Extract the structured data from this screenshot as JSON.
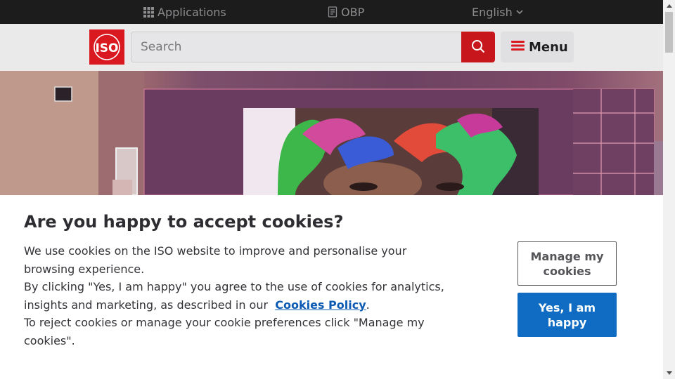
{
  "topbar": {
    "applications_label": "Applications",
    "obp_label": "OBP",
    "language_label": "English"
  },
  "header": {
    "logo_text": "ISO",
    "search_placeholder": "Search",
    "menu_label": "Menu"
  },
  "icons": {
    "applications": "grid-icon",
    "obp": "document-icon",
    "language": "chevron-down-icon",
    "search": "search-icon",
    "menu": "hamburger-icon"
  },
  "colors": {
    "brand_red": "#d9181f",
    "accept_blue": "#0f6cc2",
    "topbar_bg": "#1c1c1d",
    "link_blue": "#0d5ab3"
  },
  "cookie_banner": {
    "title": "Are you happy to accept cookies?",
    "line1": "We use cookies on the ISO website to improve and personalise your browsing experience.",
    "line2_before_link": "By clicking \"Yes, I am happy\" you agree to the use of cookies for analytics, insights and marketing, as described in our",
    "link_text": "Cookies Policy",
    "line2_after_link": ".",
    "line3": "To reject cookies or manage your cookie preferences click \"Manage my cookies\".",
    "manage_button": "Manage my cookies",
    "accept_button": "Yes, I am happy"
  }
}
